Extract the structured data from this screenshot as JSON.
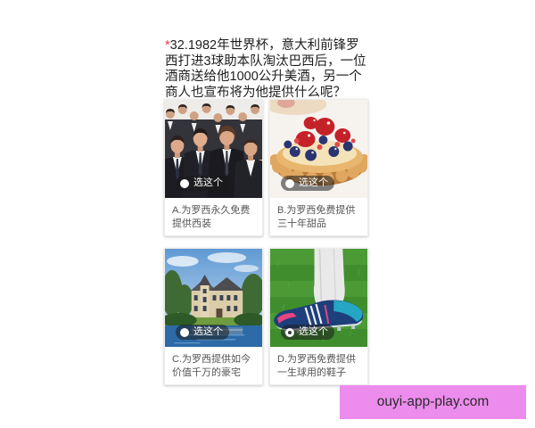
{
  "theme": {
    "required_mark": "#e23b3b",
    "watermark_bg": "#ec8ced"
  },
  "question": {
    "required_mark": "*",
    "lines": [
      "32.1982年世界杯，意大利前锋罗",
      "西打进3球助本队淘汰巴西后，一位",
      "酒商送给他1000公升美酒，另一个",
      "商人也宣布将为他提供什么呢？"
    ]
  },
  "select_label": "选这个",
  "options": [
    {
      "caption_lines": [
        "A.为罗西永久免费",
        "提供西装"
      ],
      "selected": false
    },
    {
      "caption_lines": [
        "B.为罗西免费提供",
        "三十年甜品"
      ],
      "selected": false
    },
    {
      "caption_lines": [
        "C.为罗西提供如今",
        "价值千万的豪宅"
      ],
      "selected": false
    },
    {
      "caption_lines": [
        "D.为罗西免费提供",
        "一生球用的鞋子"
      ],
      "selected": true
    }
  ],
  "watermark": {
    "text": "ouyi-app-play.com"
  }
}
